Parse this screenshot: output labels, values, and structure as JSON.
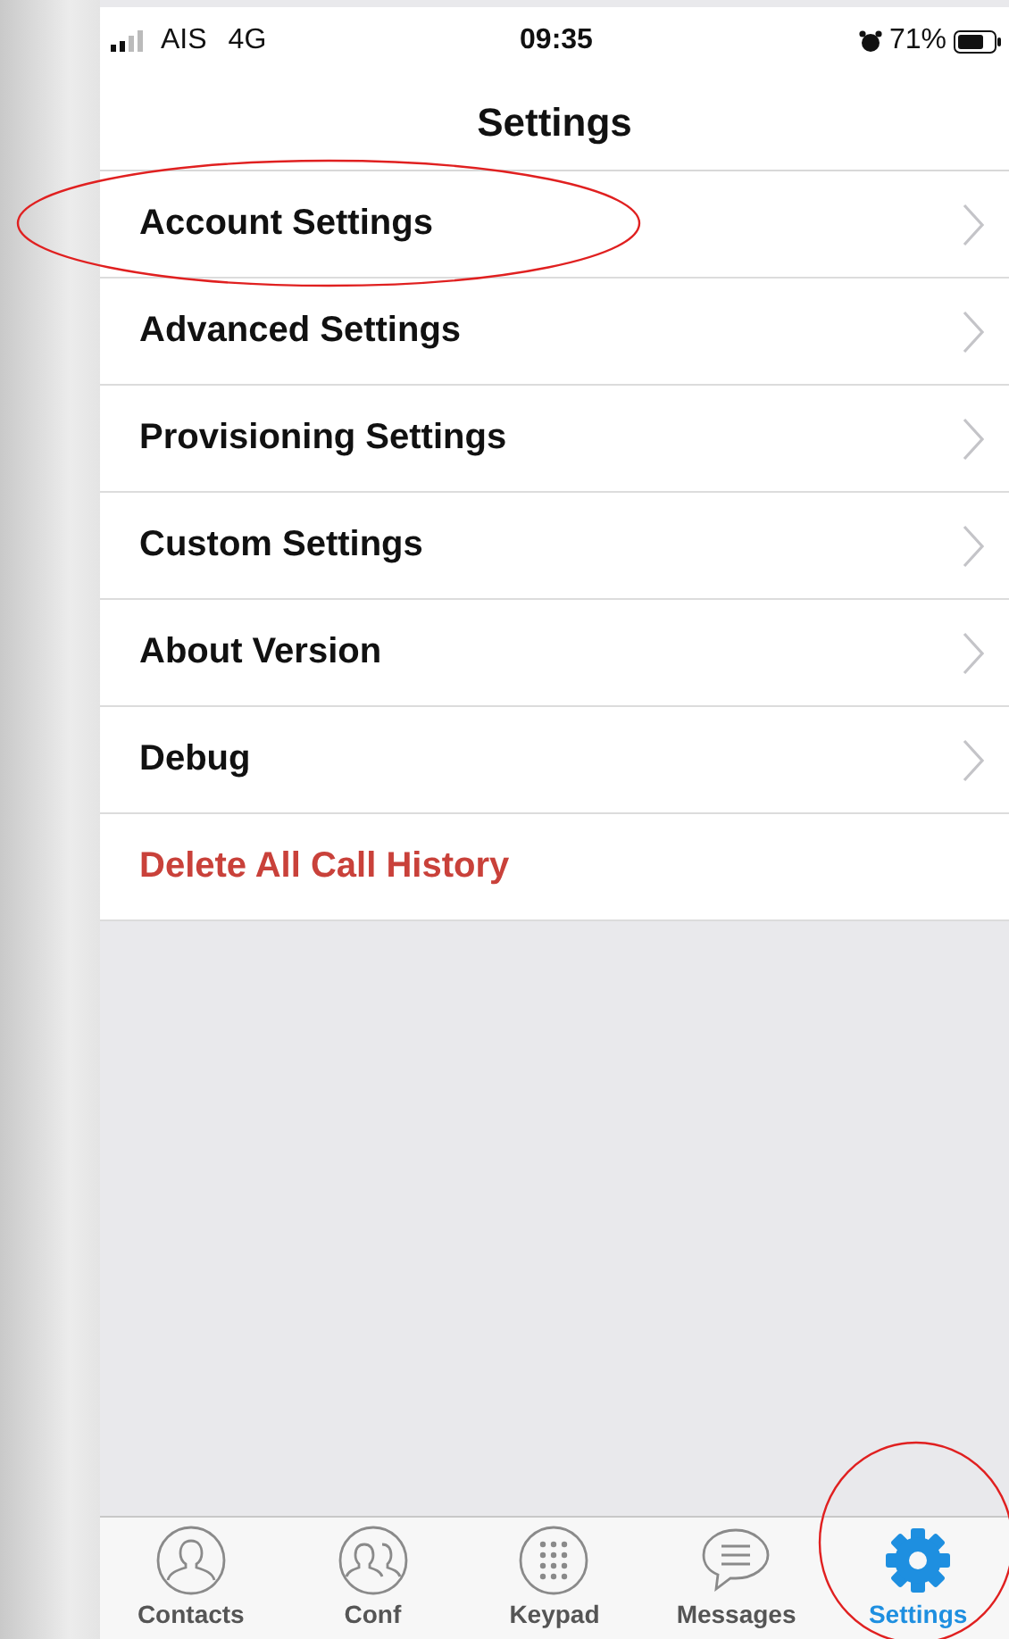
{
  "status_bar": {
    "carrier": "AIS",
    "network": "4G",
    "time": "09:35",
    "battery": "71%"
  },
  "nav_bar": {
    "title": "Settings"
  },
  "rows": [
    {
      "label": "Account Settings",
      "kind": "link",
      "highlighted": true
    },
    {
      "label": "Advanced Settings",
      "kind": "link",
      "highlighted": false
    },
    {
      "label": "Provisioning Settings",
      "kind": "link",
      "highlighted": false
    },
    {
      "label": "Custom Settings",
      "kind": "link",
      "highlighted": false
    },
    {
      "label": "About Version",
      "kind": "link",
      "highlighted": false
    },
    {
      "label": "Debug",
      "kind": "link",
      "highlighted": false
    },
    {
      "label": "Delete All Call History",
      "kind": "destructive",
      "highlighted": false
    }
  ],
  "tab_bar": [
    {
      "label": "Contacts",
      "selected": false,
      "highlighted": false
    },
    {
      "label": "Conf",
      "selected": false,
      "highlighted": false
    },
    {
      "label": "Keypad",
      "selected": false,
      "highlighted": false
    },
    {
      "label": "Messages",
      "selected": false,
      "highlighted": false
    },
    {
      "label": "Settings",
      "selected": true,
      "highlighted": true
    }
  ]
}
